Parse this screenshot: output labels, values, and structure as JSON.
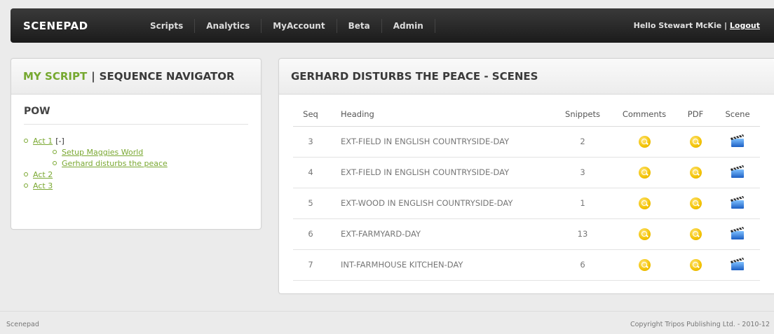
{
  "header": {
    "brand": "SCENEPAD",
    "nav": [
      "Scripts",
      "Analytics",
      "MyAccount",
      "Beta",
      "Admin"
    ],
    "greeting": "Hello Stewart McKie",
    "divider": "|",
    "logout": "Logout"
  },
  "left_panel": {
    "title_highlight": "MY SCRIPT",
    "title_sep": "|",
    "title_rest": "SEQUENCE NAVIGATOR",
    "script_name": "POW",
    "tree": {
      "act1": "Act 1",
      "act1_toggle": "[-]",
      "act1_children": [
        "Setup Maggies World",
        "Gerhard disturbs the peace"
      ],
      "act2": "Act 2",
      "act3": "Act 3"
    }
  },
  "right_panel": {
    "title": "GERHARD DISTURBS THE PEACE - SCENES",
    "columns": [
      "Seq",
      "Heading",
      "Snippets",
      "Comments",
      "PDF",
      "Scene"
    ],
    "rows": [
      {
        "seq": "3",
        "heading": "EXT-FIELD IN ENGLISH COUNTRYSIDE-DAY",
        "snippets": "2"
      },
      {
        "seq": "4",
        "heading": "EXT-FIELD IN ENGLISH COUNTRYSIDE-DAY",
        "snippets": "3"
      },
      {
        "seq": "5",
        "heading": "EXT-WOOD IN ENGLISH COUNTRYSIDE-DAY",
        "snippets": "1"
      },
      {
        "seq": "6",
        "heading": "EXT-FARMYARD-DAY",
        "snippets": "13"
      },
      {
        "seq": "7",
        "heading": "INT-FARMHOUSE KITCHEN-DAY",
        "snippets": "6"
      }
    ]
  },
  "footer": {
    "left": "Scenepad",
    "right": "Copyright Tripos Publishing Ltd. - 2010-12"
  },
  "colors": {
    "accent": "#76a830",
    "topbar": "#2a2a2a",
    "icon_yellow": "#f3c200",
    "clapper_blue": "#2f7ad8"
  }
}
